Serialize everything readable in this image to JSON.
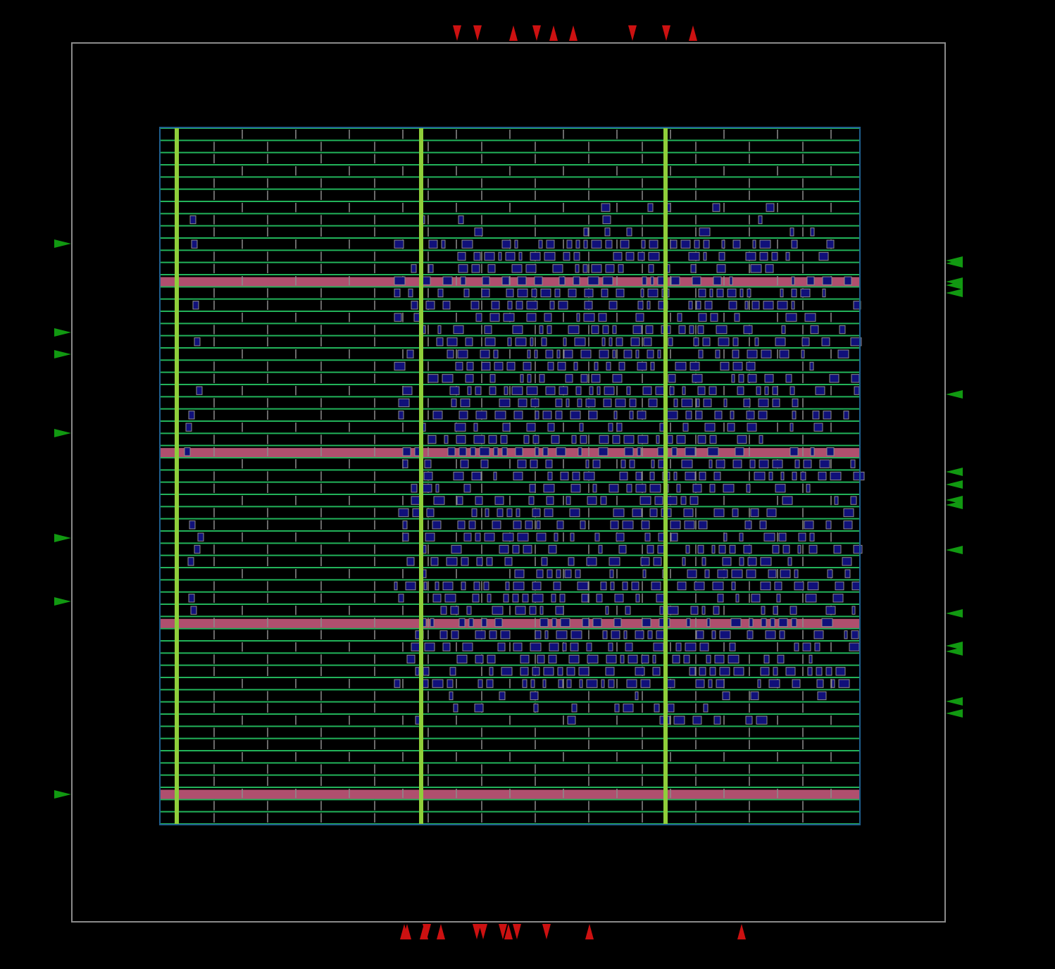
{
  "view": {
    "description_free": true,
    "colors": {
      "background": "#000000",
      "die_boundary": "#8a8a8a",
      "core_boundary": "#1f5f8f",
      "row_line": "#22b35a",
      "power_rail": "#c2587a",
      "power_strap": "#8fce3a",
      "cell_outline": "#8c8c8c",
      "cell_fill": "#10107a",
      "pin_output": "#cc1111",
      "pin_input": "#119911"
    }
  },
  "layout": {
    "row_count": 57,
    "power_rail_rows": [
      12,
      26,
      40,
      54
    ],
    "strap_count": 3,
    "pins": {
      "top": [
        {
          "dir": "down"
        },
        {
          "dir": "down"
        },
        {
          "dir": "up"
        },
        {
          "dir": "down"
        },
        {
          "dir": "up"
        },
        {
          "dir": "up"
        },
        {
          "dir": "down"
        },
        {
          "dir": "down"
        },
        {
          "dir": "up"
        }
      ],
      "bottom": [
        {
          "dir": "up"
        },
        {
          "dir": "up"
        },
        {
          "dir": "up"
        },
        {
          "dir": "down"
        },
        {
          "dir": "up"
        },
        {
          "dir": "down"
        },
        {
          "dir": "down"
        },
        {
          "dir": "down"
        },
        {
          "dir": "up"
        },
        {
          "dir": "down"
        },
        {
          "dir": "down"
        },
        {
          "dir": "up"
        },
        {
          "dir": "up"
        }
      ],
      "left": [
        {
          "dir": "right"
        },
        {
          "dir": "right"
        },
        {
          "dir": "right"
        },
        {
          "dir": "right"
        },
        {
          "dir": "right"
        },
        {
          "dir": "right"
        },
        {
          "dir": "right"
        }
      ],
      "right": [
        {
          "dir": "left"
        },
        {
          "dir": "left"
        },
        {
          "dir": "left"
        },
        {
          "dir": "left"
        },
        {
          "dir": "left"
        },
        {
          "dir": "left"
        },
        {
          "dir": "left"
        },
        {
          "dir": "left"
        },
        {
          "dir": "left"
        },
        {
          "dir": "left"
        },
        {
          "dir": "left"
        },
        {
          "dir": "left"
        },
        {
          "dir": "left"
        },
        {
          "dir": "left"
        },
        {
          "dir": "left"
        },
        {
          "dir": "left"
        }
      ]
    }
  }
}
